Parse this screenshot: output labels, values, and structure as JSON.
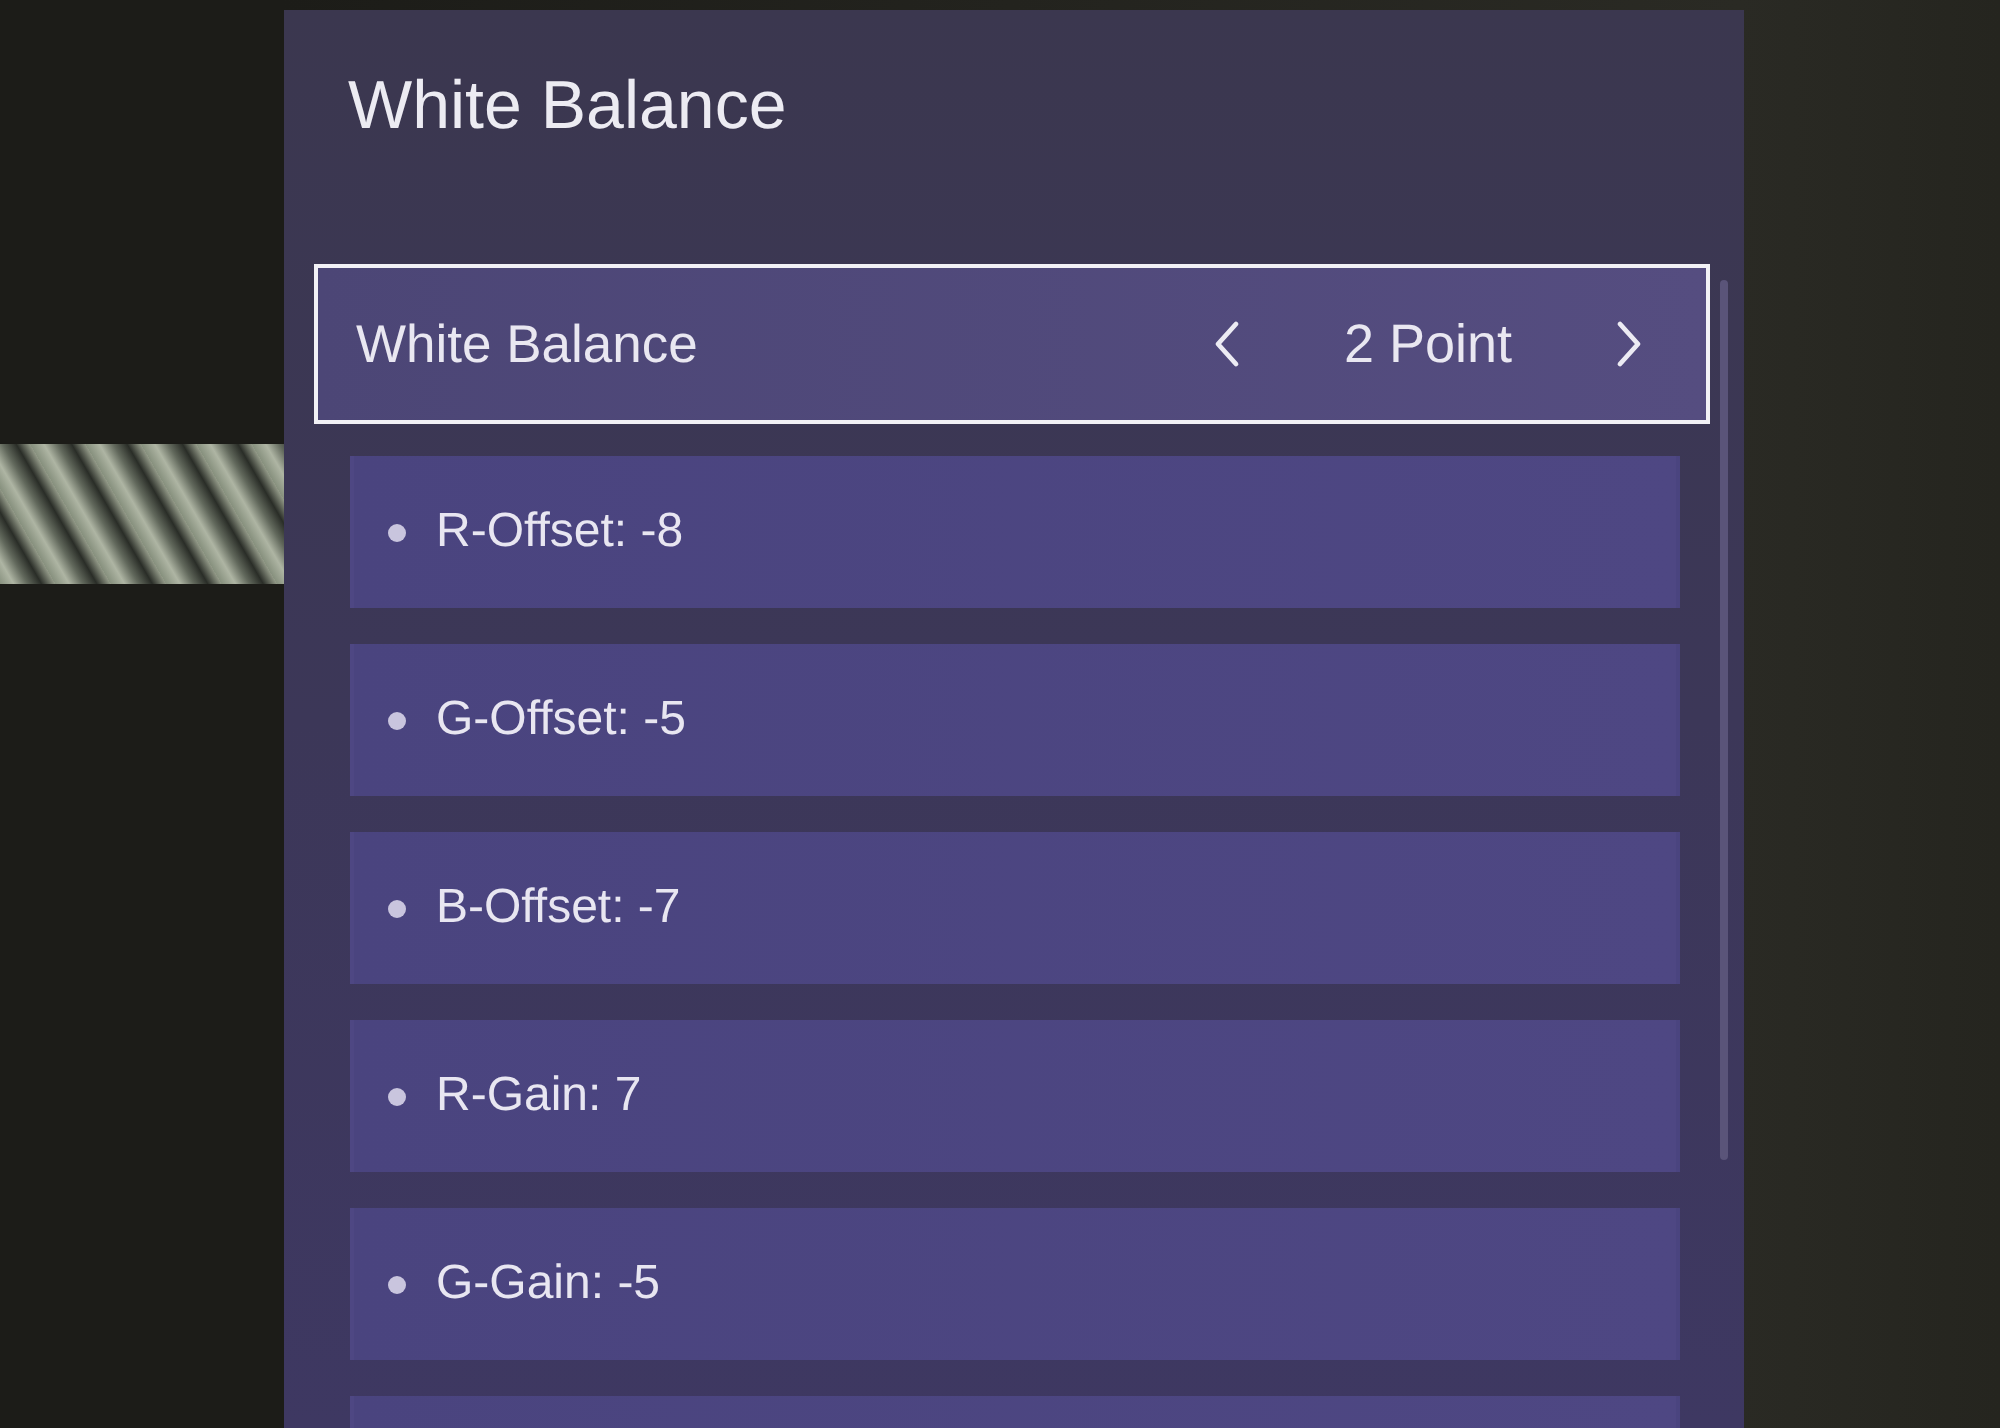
{
  "menu": {
    "title": "White Balance"
  },
  "rows": [
    {
      "kind": "selector",
      "label": "White Balance",
      "value": "2 Point",
      "selected": true
    },
    {
      "kind": "setting",
      "label": "R-Offset: -8",
      "selected": false
    },
    {
      "kind": "setting",
      "label": "G-Offset: -5",
      "selected": false
    },
    {
      "kind": "setting",
      "label": "B-Offset: -7",
      "selected": false
    },
    {
      "kind": "setting",
      "label": "R-Gain: 7",
      "selected": false
    },
    {
      "kind": "setting",
      "label": "G-Gain: -5",
      "selected": false
    }
  ],
  "list": {
    "more_below": true
  }
}
